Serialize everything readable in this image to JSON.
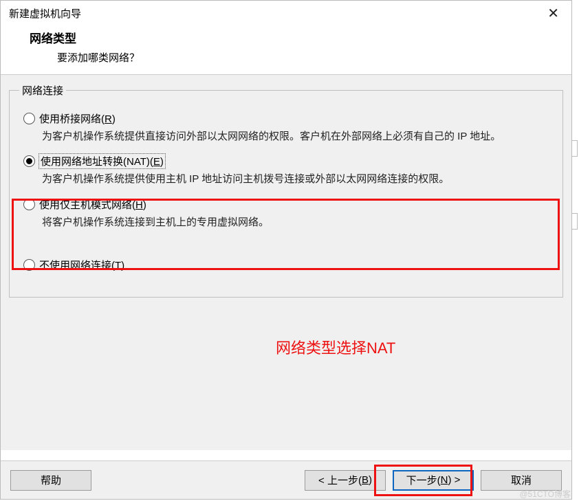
{
  "window": {
    "title": "新建虚拟机向导",
    "close_glyph": "✕"
  },
  "header": {
    "title": "网络类型",
    "subtitle": "要添加哪类网络？"
  },
  "group": {
    "legend": "网络连接"
  },
  "options": {
    "bridged": {
      "label_pre": "使用桥接网络(",
      "hotkey": "R",
      "label_post": ")",
      "desc": "为客户机操作系统提供直接访问外部以太网网络的权限。客户机在外部网络上必须有自己的 IP 地址。"
    },
    "nat": {
      "label_pre": "使用网络地址转换(NAT)(",
      "hotkey": "E",
      "label_post": ")",
      "desc": "为客户机操作系统提供使用主机 IP 地址访问主机拨号连接或外部以太网网络连接的权限。"
    },
    "hostonly": {
      "label_pre": "使用仅主机模式网络(",
      "hotkey": "H",
      "label_post": ")",
      "desc": "将客户机操作系统连接到主机上的专用虚拟网络。"
    },
    "none": {
      "label_pre": "不使用网络连接(",
      "hotkey": "T",
      "label_post": ")"
    }
  },
  "annotation": {
    "text": "网络类型选择NAT"
  },
  "buttons": {
    "help": "帮助",
    "back_pre": "< 上一步(",
    "back_hot": "B",
    "back_post": ")",
    "next_pre": "下一步(",
    "next_hot": "N",
    "next_post": ") >",
    "cancel": "取消"
  },
  "watermark": "@51CTO博客"
}
